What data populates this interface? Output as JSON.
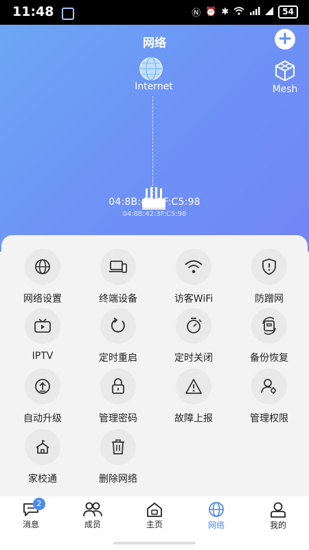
{
  "status_bar": {
    "time": "11:48",
    "battery": "54"
  },
  "header": {
    "title": "网络",
    "add_symbol": "+"
  },
  "topology": {
    "internet_label": "Internet",
    "mesh_label": "Mesh",
    "router_mac": "04:8B:42:3F:C5:98",
    "router_mac_sub": "04:8B:42:3F:C5:98"
  },
  "grid": [
    {
      "label": "网络设置",
      "icon": "globe-icon"
    },
    {
      "label": "终端设备",
      "icon": "devices-icon"
    },
    {
      "label": "访客WiFi",
      "icon": "wifi-icon"
    },
    {
      "label": "防蹭网",
      "icon": "shield-icon"
    },
    {
      "label": "IPTV",
      "icon": "tv-icon"
    },
    {
      "label": "定时重启",
      "icon": "restart-icon"
    },
    {
      "label": "定时关闭",
      "icon": "timer-off-icon"
    },
    {
      "label": "备份恢复",
      "icon": "backup-icon"
    },
    {
      "label": "自动升级",
      "icon": "upgrade-icon"
    },
    {
      "label": "管理密码",
      "icon": "lock-icon"
    },
    {
      "label": "故障上报",
      "icon": "warning-icon"
    },
    {
      "label": "管理权限",
      "icon": "admin-icon"
    },
    {
      "label": "家校通",
      "icon": "school-icon"
    },
    {
      "label": "删除网络",
      "icon": "trash-icon"
    }
  ],
  "tabs": [
    {
      "label": "消息",
      "badge": "2",
      "icon": "message-icon"
    },
    {
      "label": "成员",
      "icon": "members-icon"
    },
    {
      "label": "主页",
      "icon": "home-icon"
    },
    {
      "label": "网络",
      "icon": "network-icon",
      "active": true
    },
    {
      "label": "我的",
      "icon": "profile-icon"
    }
  ],
  "colors": {
    "accent": "#4b8af2",
    "gradient_start": "#6ca7f4",
    "gradient_end": "#7285f5"
  }
}
